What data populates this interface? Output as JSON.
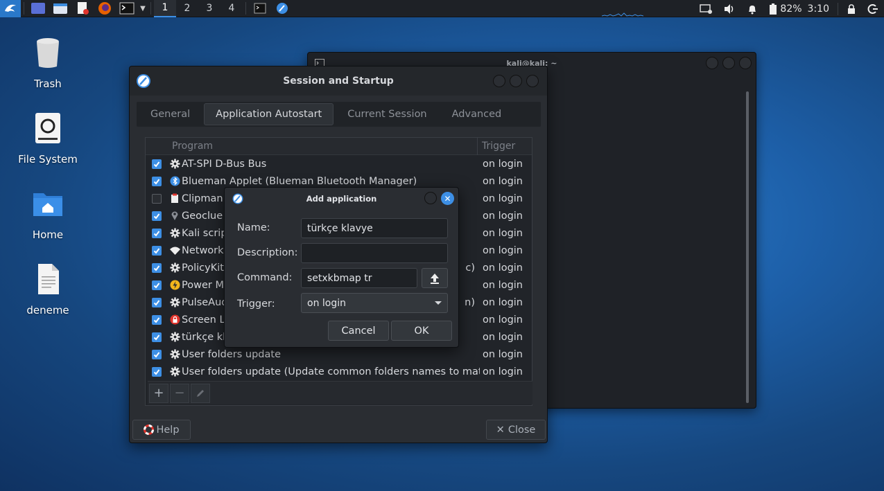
{
  "panel": {
    "workspaces": [
      "1",
      "2",
      "3",
      "4"
    ],
    "active_workspace": "1",
    "battery": "82%",
    "clock": "3:10"
  },
  "desktop": {
    "icons": [
      {
        "label": "Trash",
        "icon": "trash-icon"
      },
      {
        "label": "File System",
        "icon": "drive-icon"
      },
      {
        "label": "Home",
        "icon": "home-folder-icon"
      },
      {
        "label": "deneme",
        "icon": "text-file-icon"
      }
    ]
  },
  "terminal": {
    "title": "kali@kali: ~"
  },
  "session": {
    "title": "Session and Startup",
    "tabs": [
      "General",
      "Application Autostart",
      "Current Session",
      "Advanced"
    ],
    "active_tab": "Application Autostart",
    "columns": {
      "program": "Program",
      "trigger": "Trigger"
    },
    "rows": [
      {
        "name": "AT-SPI D-Bus Bus",
        "trigger": "on login",
        "checked": true,
        "icon": "gear-icon"
      },
      {
        "name": "Blueman Applet (Blueman Bluetooth Manager)",
        "trigger": "on login",
        "checked": true,
        "icon": "bluetooth-icon"
      },
      {
        "name": "Clipman (",
        "trigger": "on login",
        "checked": false,
        "icon": "clipboard-icon"
      },
      {
        "name": "Geoclue D",
        "trigger": "on login",
        "checked": true,
        "icon": "location-icon"
      },
      {
        "name": "Kali script",
        "trigger": "on login",
        "checked": true,
        "icon": "gear-icon"
      },
      {
        "name": "Network (",
        "trigger": "on login",
        "checked": true,
        "icon": "wifi-icon"
      },
      {
        "name": "PolicyKit A",
        "trigger": "on login",
        "checked": true,
        "icon": "gear-icon"
      },
      {
        "name": "Power Ma",
        "trigger": "on login",
        "checked": true,
        "icon": "power-icon"
      },
      {
        "name": "PulseAud",
        "trigger": "on login",
        "checked": true,
        "icon": "gear-icon"
      },
      {
        "name": "Screen Lo",
        "trigger": "on login",
        "checked": true,
        "icon": "lock-icon"
      },
      {
        "name": "türkçe kla",
        "trigger": "on login",
        "checked": true,
        "icon": "gear-icon"
      },
      {
        "name": "User folders update",
        "trigger": "on login",
        "checked": true,
        "icon": "gear-icon"
      },
      {
        "name": "User folders update (Update common folders names to match c…",
        "trigger": "on login",
        "checked": true,
        "icon": "gear-icon"
      }
    ],
    "help_label": "Help",
    "close_label": "Close",
    "row_suffixes": {
      "policykit": "c)",
      "pulseaudio": "n)"
    }
  },
  "dialog": {
    "title": "Add application",
    "name_label": "Name:",
    "name_value": "türkçe klavye",
    "description_label": "Description:",
    "description_value": "",
    "command_label": "Command:",
    "command_value": "setxkbmap tr",
    "trigger_label": "Trigger:",
    "trigger_value": "on login",
    "cancel_label": "Cancel",
    "ok_label": "OK"
  },
  "colors": {
    "accent": "#3d8fe5",
    "window_bg": "#2a2d32",
    "panel_bg": "#1e2126"
  }
}
